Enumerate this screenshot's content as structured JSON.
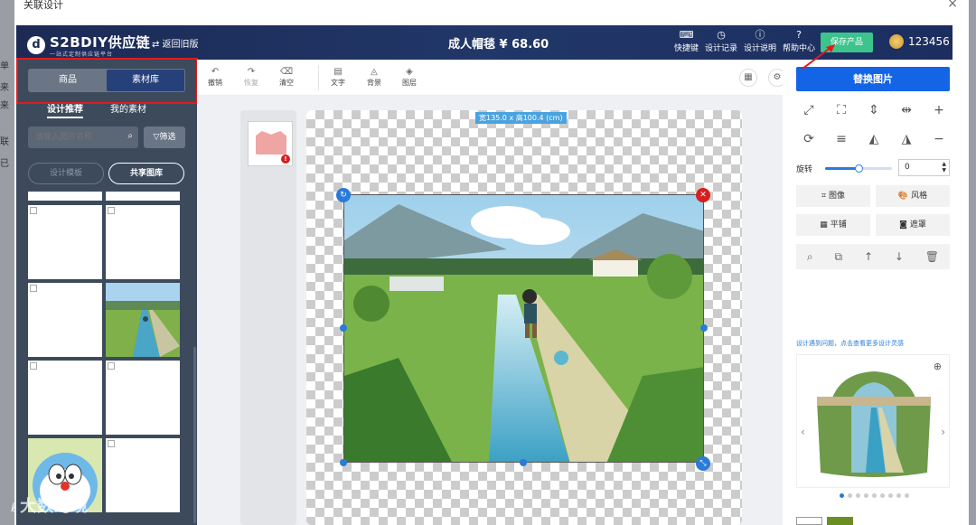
{
  "background": {
    "left_text": [
      "单",
      "来",
      "来",
      "联",
      "已"
    ]
  },
  "modal": {
    "title": "关联设计",
    "close_icon": "×"
  },
  "topbar": {
    "logo_mark": "d",
    "logo_text": "S2BDIY供应链",
    "logo_sub": "一站式定制供应链平台",
    "back_label": "⇄ 返回旧版",
    "product_title": "成人帽毯 ¥ 68.60",
    "items": [
      {
        "label": "快捷键",
        "icon": "keyboard-icon",
        "glyph": "⌨"
      },
      {
        "label": "设计记录",
        "icon": "history-icon",
        "glyph": "◷"
      },
      {
        "label": "设计说明",
        "icon": "info-icon",
        "glyph": "ⓘ"
      },
      {
        "label": "帮助中心",
        "icon": "help-icon",
        "glyph": "?"
      }
    ],
    "save_label": "保存产品",
    "user_name": "123456",
    "user_chevron": "∨"
  },
  "left_panel": {
    "tabs": [
      "商品",
      "素材库"
    ],
    "active_tab": 1,
    "subtabs": [
      "设计推荐",
      "我的素材"
    ],
    "search_placeholder": "请输入图片名称",
    "filter_label": "▽筛选",
    "template_label": "设计模板",
    "gallery_label": "共享图库",
    "collapse_glyph": "›"
  },
  "toolbar": {
    "tools": [
      {
        "label": "撤销",
        "icon": "undo-icon",
        "glyph": "↶"
      },
      {
        "label": "恢复",
        "icon": "redo-icon",
        "glyph": "↷"
      },
      {
        "label": "清空",
        "icon": "eraser-icon",
        "glyph": "⌫"
      },
      {
        "label": "文字",
        "icon": "text-icon",
        "glyph": "▤"
      },
      {
        "label": "背景",
        "icon": "fill-icon",
        "glyph": "◬"
      },
      {
        "label": "图层",
        "icon": "layers-icon",
        "glyph": "◈"
      }
    ],
    "grid_glyph": "▦",
    "settings_glyph": "⚙"
  },
  "canvas": {
    "dimensions": "宽135.0 x 高100.4 (cm)",
    "view_error": "!"
  },
  "right_panel": {
    "replace_label": "替换图片",
    "tool_glyphs": [
      "⤢",
      "⛶",
      "⇕",
      "⇹",
      "+",
      "⟳",
      "≡",
      "◭",
      "◮",
      "−"
    ],
    "rotate_label": "旋转",
    "rotate_value": "0",
    "rotate_slider_fraction": 0.5,
    "fx_buttons": [
      {
        "label": "图像",
        "icon": "crop-icon",
        "glyph": "⌗"
      },
      {
        "label": "风格",
        "icon": "palette-icon",
        "glyph": "🎨"
      },
      {
        "label": "平铺",
        "icon": "tile-icon",
        "glyph": "▦"
      },
      {
        "label": "遮罩",
        "icon": "mask-icon",
        "glyph": "◙"
      }
    ],
    "actions": [
      "⌕",
      "⧉",
      "↑",
      "↓",
      "🗑"
    ],
    "help_link": "设计遇到问题，点击查看更多设计灵感",
    "dot_count": 9,
    "swatch_colors": [
      "#ffffff",
      "#6b8e23"
    ]
  },
  "watermark": "大数跨境"
}
